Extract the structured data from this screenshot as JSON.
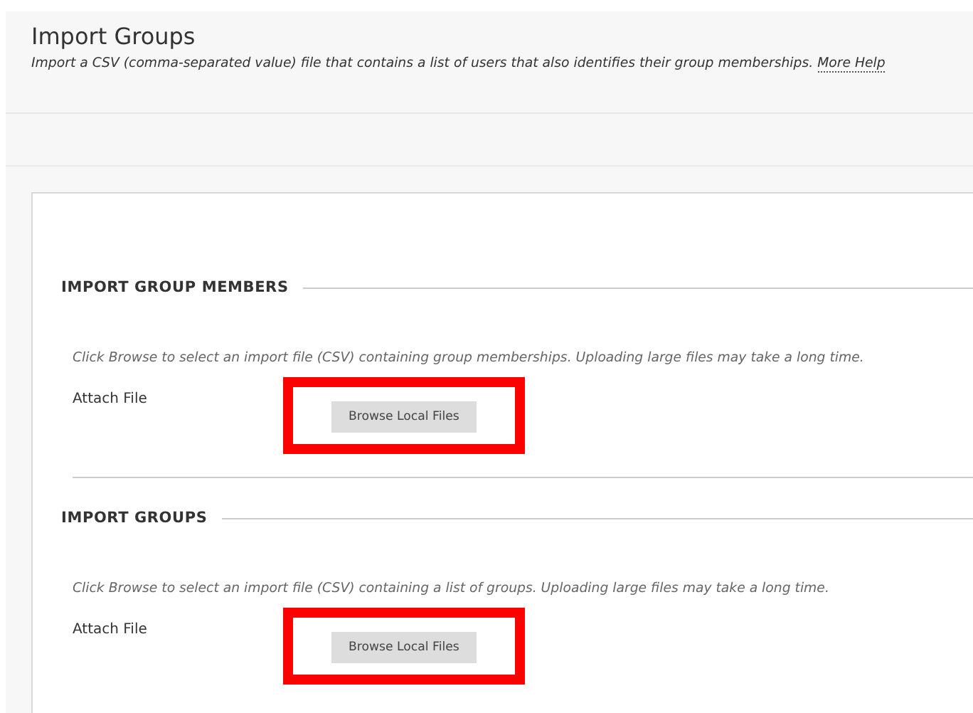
{
  "header": {
    "title": "Import Groups",
    "description": "Import a CSV (comma-separated value) file that contains a list of users that also identifies their group memberships.",
    "help_link": "More Help"
  },
  "sections": [
    {
      "heading": "IMPORT GROUP MEMBERS",
      "instructions": "Click Browse to select an import file (CSV) containing group memberships. Uploading large files may take a long time.",
      "field_label": "Attach File",
      "button": "Browse Local Files",
      "highlighted": true
    },
    {
      "heading": "IMPORT GROUPS",
      "instructions": "Click Browse to select an import file (CSV) containing a list of groups. Uploading large files may take a long time.",
      "field_label": "Attach File",
      "button": "Browse Local Files",
      "highlighted": true
    }
  ]
}
